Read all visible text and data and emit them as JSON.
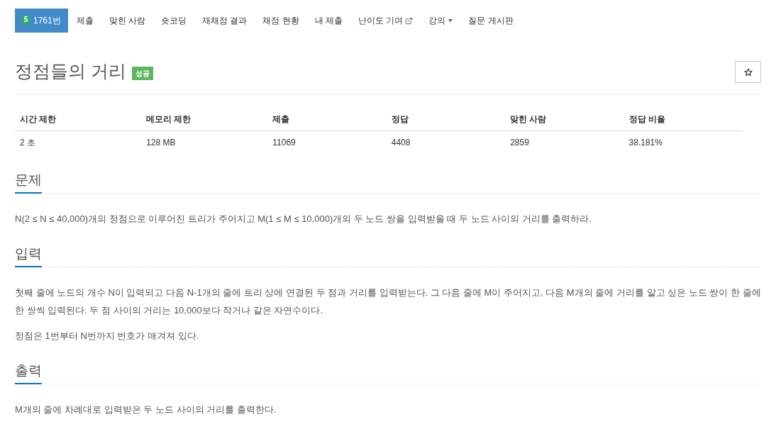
{
  "nav_tabs": [
    {
      "kind": "problem",
      "tier": "5",
      "label": "1761번",
      "selected": true
    },
    {
      "kind": "plain",
      "label": "제출",
      "selected": false
    },
    {
      "kind": "plain",
      "label": "맞힌 사람",
      "selected": false
    },
    {
      "kind": "plain",
      "label": "숏코딩",
      "selected": false
    },
    {
      "kind": "plain",
      "label": "재채점 결과",
      "selected": false
    },
    {
      "kind": "plain",
      "label": "채점 현황",
      "selected": false
    },
    {
      "kind": "plain",
      "label": "내 제출",
      "selected": false
    },
    {
      "kind": "external",
      "label": "난이도 기여",
      "selected": false
    },
    {
      "kind": "dropdown",
      "label": "강의",
      "selected": false
    },
    {
      "kind": "plain",
      "label": "질문 게시판",
      "selected": false
    }
  ],
  "problem": {
    "title": "정점들의 거리",
    "result_label": "성공"
  },
  "info_table": {
    "columns": [
      "시간 제한",
      "메모리 제한",
      "제출",
      "정답",
      "맞힌 사람",
      "정답 비율"
    ],
    "rows": [
      [
        "2 초",
        "128 MB",
        "11069",
        "4408",
        "2859",
        "38.181%"
      ]
    ]
  },
  "sections": [
    {
      "heading": "문제",
      "paragraphs": [
        "N(2 ≤ N ≤ 40,000)개의 정점으로 이루어진 트리가 주어지고 M(1 ≤ M ≤ 10,000)개의 두 노드 쌍을 입력받을 때 두 노드 사이의 거리를 출력하라."
      ]
    },
    {
      "heading": "입력",
      "paragraphs": [
        "첫째 줄에 노드의 개수 N이 입력되고 다음 N-1개의 줄에 트리 상에 연결된 두 점과 거리를 입력받는다. 그 다음 줄에 M이 주어지고, 다음 M개의 줄에 거리를 알고 싶은 노드 쌍이 한 줄에 한 쌍씩 입력된다. 두 점 사이의 거리는 10,000보다 작거나 같은 자연수이다.",
        "정점은 1번부터 N번까지 번호가 매겨져 있다."
      ]
    },
    {
      "heading": "출력",
      "paragraphs": [
        "M개의 줄에 차례대로 입력받은 두 노드 사이의 거리를 출력한다."
      ]
    }
  ]
}
